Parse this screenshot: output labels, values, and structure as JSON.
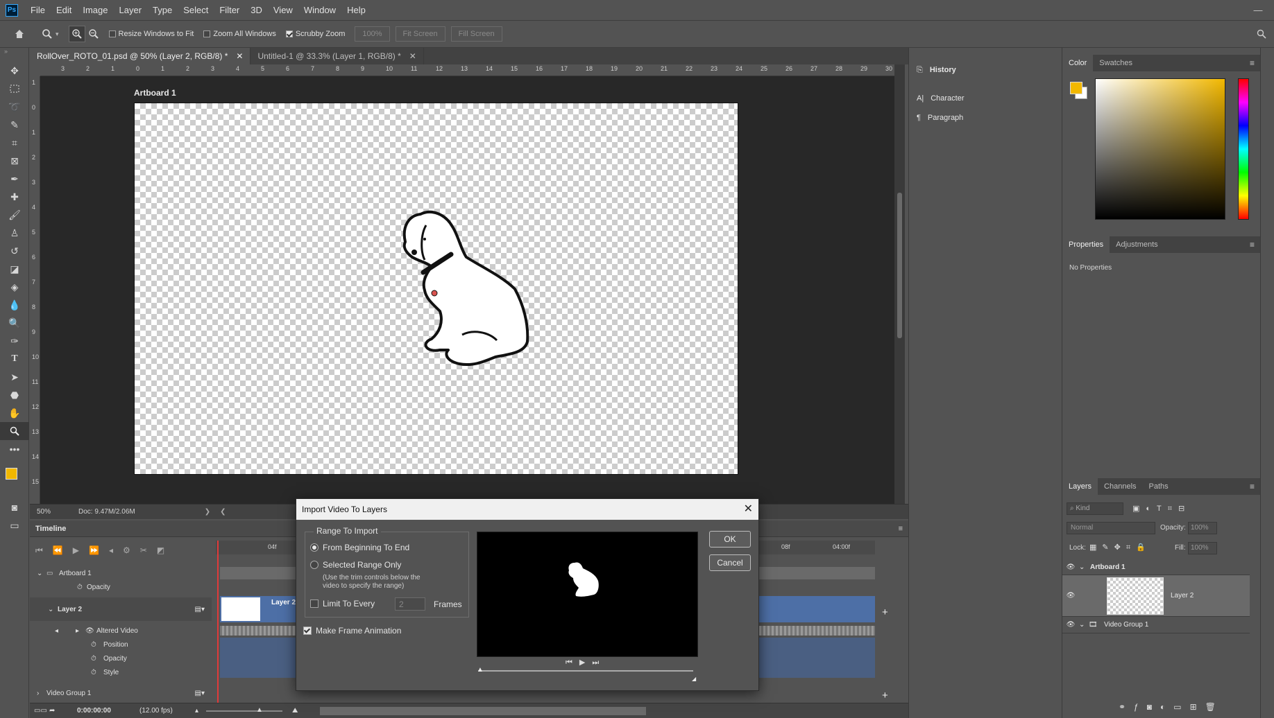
{
  "app": {
    "logo": "Ps"
  },
  "menu": [
    "File",
    "Edit",
    "Image",
    "Layer",
    "Type",
    "Select",
    "Filter",
    "3D",
    "View",
    "Window",
    "Help"
  ],
  "options": {
    "resize_windows": "Resize Windows to Fit",
    "zoom_all": "Zoom All Windows",
    "scrubby_zoom": "Scrubby Zoom",
    "zoom_value": "100%",
    "fit_screen": "Fit Screen",
    "fill_screen": "Fill Screen"
  },
  "tabs": [
    {
      "label": "RollOver_ROTO_01.psd @ 50% (Layer 2, RGB/8) *",
      "active": true
    },
    {
      "label": "Untitled-1 @ 33.3% (Layer 1, RGB/8) *",
      "active": false
    }
  ],
  "ruler_h": [
    "3",
    "2",
    "1",
    "0",
    "1",
    "2",
    "3",
    "4",
    "5",
    "6",
    "7",
    "8",
    "9",
    "10",
    "11",
    "12",
    "13",
    "14",
    "15",
    "16",
    "17",
    "18",
    "19",
    "20",
    "21",
    "22",
    "23",
    "24",
    "25",
    "26",
    "27",
    "28",
    "29",
    "30"
  ],
  "ruler_v": [
    "1",
    "0",
    "1",
    "2",
    "3",
    "4",
    "5",
    "6",
    "7",
    "8",
    "9",
    "10",
    "11",
    "12",
    "13",
    "14",
    "15"
  ],
  "canvas": {
    "artboard_label": "Artboard 1"
  },
  "status": {
    "zoom": "50%",
    "doc": "Doc: 9.47M/2.06M"
  },
  "timeline": {
    "title": "Timeline",
    "ruler_marks": [
      "04f",
      "08f",
      "04:00f"
    ],
    "rows": {
      "artboard": "Artboard 1",
      "opacity1": "Opacity",
      "layer2": "Layer 2",
      "altered": "Altered Video",
      "position": "Position",
      "opacity2": "Opacity",
      "style": "Style",
      "video_group": "Video Group 1"
    },
    "clip_label": "Layer 2",
    "time": "0:00:00:00",
    "fps": "(12.00 fps)"
  },
  "mid_panel": {
    "history": "History",
    "character": "Character",
    "paragraph": "Paragraph"
  },
  "color_panel": {
    "tabs": [
      "Color",
      "Swatches"
    ],
    "fg": "#f2b800",
    "bg": "#ffffff"
  },
  "properties_panel": {
    "tabs": [
      "Properties",
      "Adjustments"
    ],
    "empty": "No Properties"
  },
  "layers_panel": {
    "tabs": [
      "Layers",
      "Channels",
      "Paths"
    ],
    "filter_placeholder": "Kind",
    "blend": "Normal",
    "opacity_label": "Opacity:",
    "opacity_value": "100%",
    "lock_label": "Lock:",
    "fill_label": "Fill:",
    "fill_value": "100%",
    "layers": [
      "Artboard 1",
      "Layer 2",
      "Video Group 1"
    ]
  },
  "dialog": {
    "title": "Import Video To Layers",
    "range_legend": "Range To Import",
    "opt1": "From Beginning To End",
    "opt2": "Selected Range Only",
    "opt2_note_1": "(Use the trim controls below the",
    "opt2_note_2": "video to specify the range)",
    "limit": "Limit To Every",
    "limit_value": "2",
    "frames": "Frames",
    "frame_anim": "Make Frame Animation",
    "ok": "OK",
    "cancel": "Cancel"
  }
}
